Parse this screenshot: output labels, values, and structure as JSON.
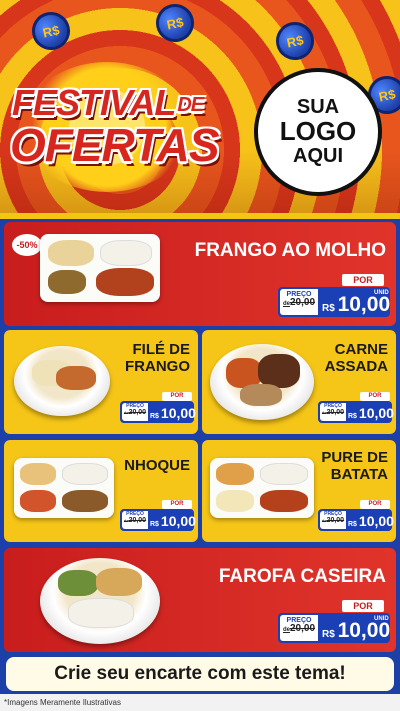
{
  "header": {
    "coin_label": "R$",
    "title_line1": "FESTIVAL",
    "title_de": "DE",
    "title_line2": "OFERTAS",
    "logo": {
      "line1": "SUA",
      "line2": "LOGO",
      "line3": "AQUI"
    }
  },
  "price_labels": {
    "por": "POR",
    "preco": "PREÇO",
    "de": "de",
    "old": "20,00",
    "currency": "R$",
    "unid": "UNID"
  },
  "products": [
    {
      "name_line1": "FRANGO AO MOLHO",
      "name_line2": "",
      "price": "10,00",
      "discount": "-50%"
    },
    {
      "name_line1": "FILÉ DE",
      "name_line2": "FRANGO",
      "price": "10,00"
    },
    {
      "name_line1": "CARNE",
      "name_line2": "ASSADA",
      "price": "10,00"
    },
    {
      "name_line1": "NHOQUE",
      "name_line2": "",
      "price": "10,00"
    },
    {
      "name_line1": "PURE DE",
      "name_line2": "BATATA",
      "price": "10,00"
    },
    {
      "name_line1": "FAROFA CASEIRA",
      "name_line2": "",
      "price": "10,00"
    }
  ],
  "footer": {
    "cta": "Crie seu encarte com este tema!",
    "disclaimer": "*Imagens Meramente Ilustrativas"
  },
  "colors": {
    "red": "#c81d1d",
    "yellow": "#f5c517",
    "blue": "#1b3fb5",
    "background": "#1d3fa8"
  }
}
